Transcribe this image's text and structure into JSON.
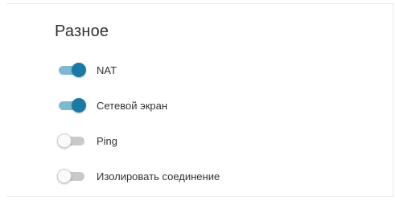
{
  "section": {
    "title": "Разное"
  },
  "toggles": [
    {
      "label": "NAT",
      "state": "on"
    },
    {
      "label": "Сетевой экран",
      "state": "on"
    },
    {
      "label": "Ping",
      "state": "off"
    },
    {
      "label": "Изолировать соединение",
      "state": "off"
    }
  ],
  "colors": {
    "toggle_on_thumb": "#1a7aa6",
    "toggle_on_track": "#7fb9d1",
    "toggle_off_track": "#c9c9c9"
  }
}
